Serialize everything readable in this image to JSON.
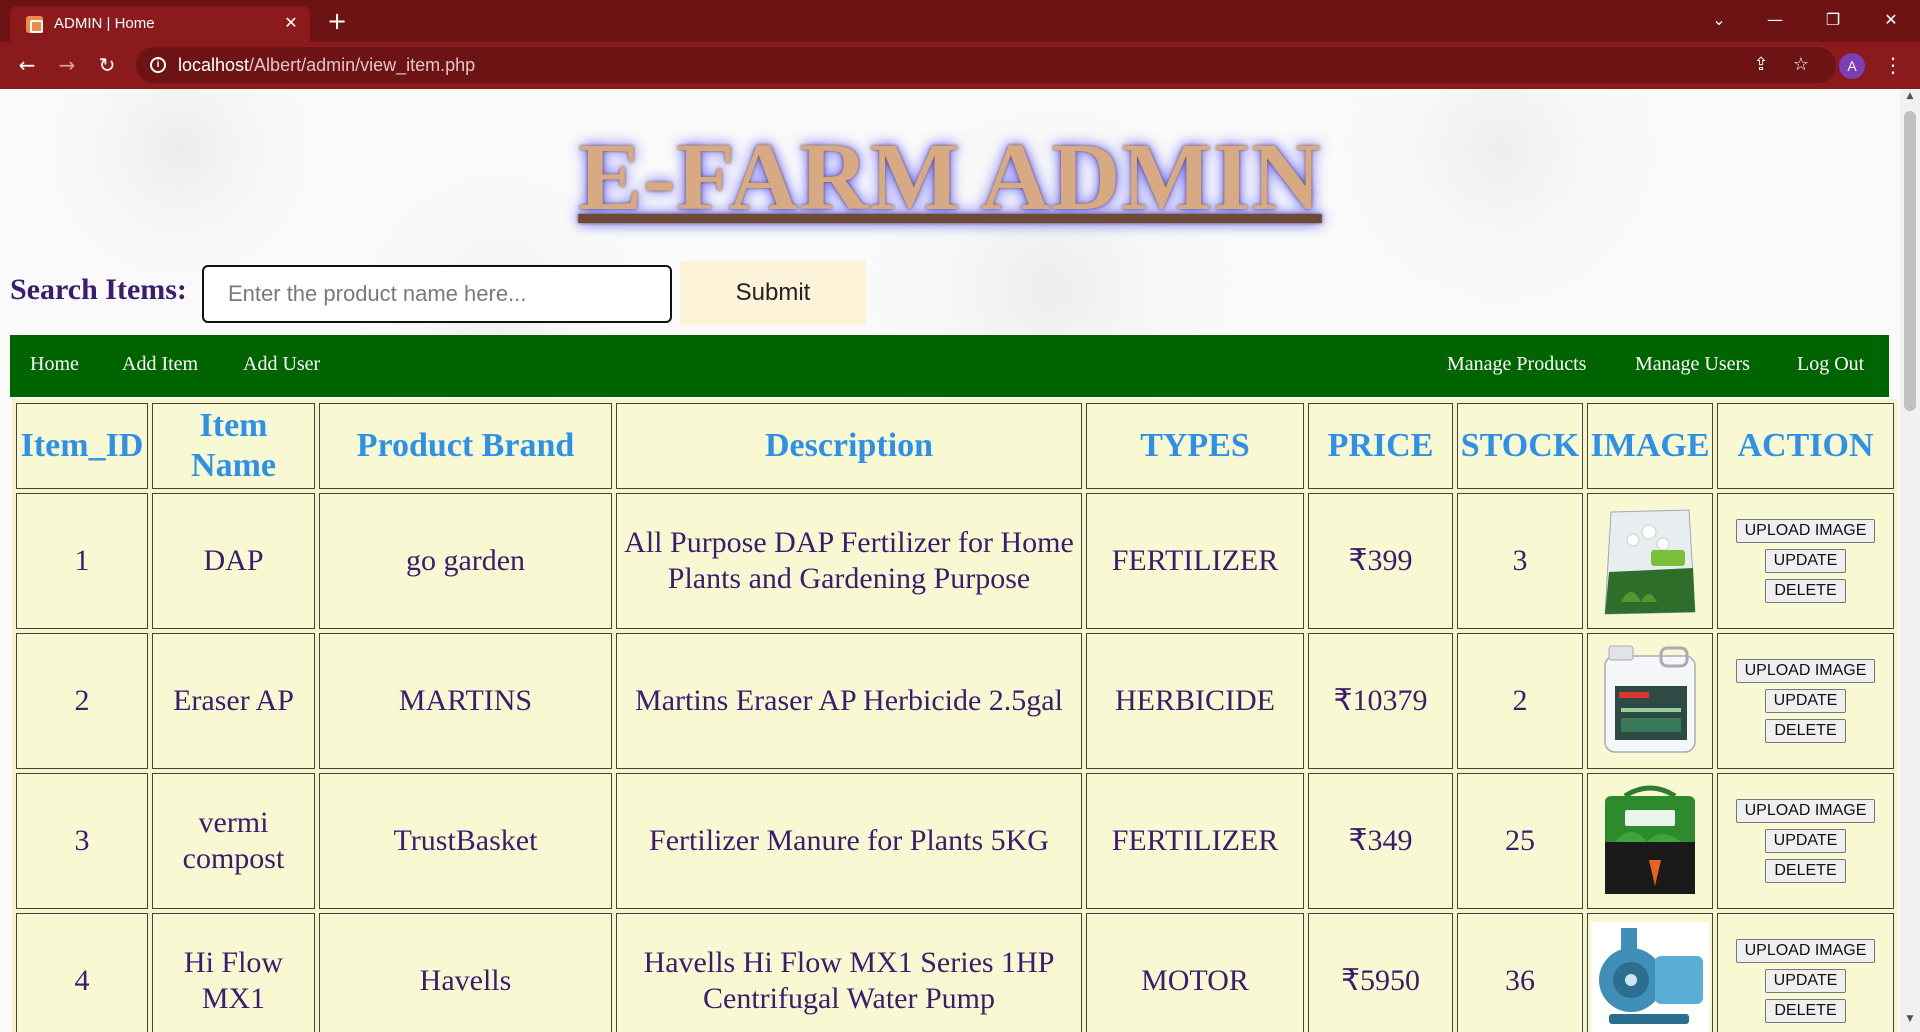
{
  "browser": {
    "tab_title": "ADMIN | Home",
    "url_host": "localhost",
    "url_path": "/Albert/admin/view_item.php",
    "avatar_letter": "A"
  },
  "page": {
    "title": "E-FARM ADMIN",
    "search_label": "Search Items:",
    "search_placeholder": "Enter the product name here...",
    "submit_label": "Submit"
  },
  "nav": {
    "left": [
      "Home",
      "Add Item",
      "Add User"
    ],
    "right": [
      "Manage Products",
      "Manage Users",
      "Log Out"
    ]
  },
  "table": {
    "headers": [
      "Item_ID",
      "Item Name",
      "Product Brand",
      "Description",
      "TYPES",
      "PRICE",
      "STOCK",
      "IMAGE",
      "ACTION"
    ],
    "action_labels": [
      "UPLOAD IMAGE",
      "UPDATE",
      "DELETE"
    ],
    "rows": [
      {
        "id": "1",
        "name": "DAP",
        "brand": "go garden",
        "description": "All Purpose DAP Fertilizer for Home Plants and Gardening Purpose",
        "type": "FERTILIZER",
        "price": "₹399",
        "stock": "3",
        "image": "dap-fertilizer-bag"
      },
      {
        "id": "2",
        "name": "Eraser AP",
        "brand": "MARTINS",
        "description": "Martins Eraser AP Herbicide 2.5gal",
        "type": "HERBICIDE",
        "price": "₹10379",
        "stock": "2",
        "image": "herbicide-jug"
      },
      {
        "id": "3",
        "name": "vermi compost",
        "brand": "TrustBasket",
        "description": "Fertilizer Manure for Plants 5KG",
        "type": "FERTILIZER",
        "price": "₹349",
        "stock": "25",
        "image": "vermi-compost-bag"
      },
      {
        "id": "4",
        "name": "Hi Flow MX1",
        "brand": "Havells",
        "description": "Havells Hi Flow MX1 Series 1HP Centrifugal Water Pump",
        "type": "MOTOR",
        "price": "₹5950",
        "stock": "36",
        "image": "water-pump"
      }
    ]
  },
  "colors": {
    "chrome_dark": "#6e1314",
    "chrome": "#8b1a1c",
    "navbar": "#006400",
    "header_text": "#2e91e8",
    "cell_text": "#3b1c6e",
    "cell_bg": "#f8f8d2",
    "title": "#d7aa84"
  }
}
